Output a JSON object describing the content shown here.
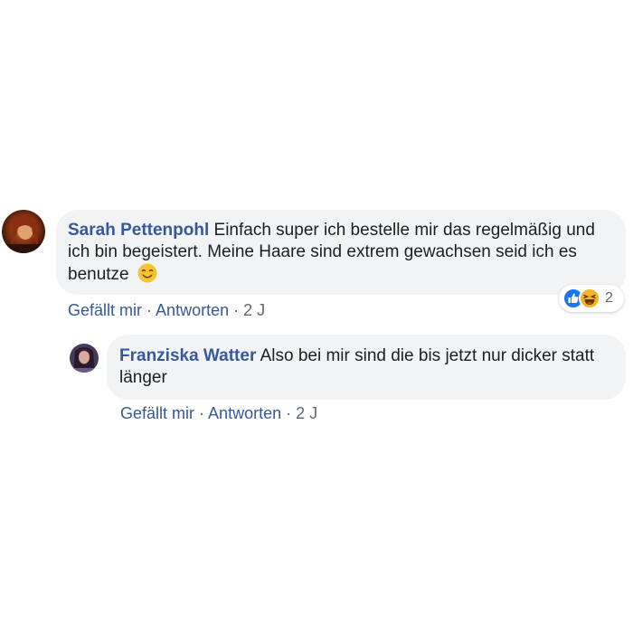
{
  "comments": [
    {
      "author": "Sarah Pettenpohl",
      "text": "Einfach super ich bestelle mir das regelmäßig und ich bin begeistert. Meine Haare sind extrem gewachsen seid ich es benutze",
      "emoji": "smiling-face-icon",
      "actions": {
        "like": "Gefällt mir",
        "reply": "Antworten",
        "time": "2 J"
      },
      "reactions": {
        "icons": [
          "like-reaction-icon",
          "haha-reaction-icon"
        ],
        "count": "2"
      }
    },
    {
      "author": "Franziska Watter",
      "text": "Also bei mir sind die bis jetzt nur dicker statt länger",
      "actions": {
        "like": "Gefällt mir",
        "reply": "Antworten",
        "time": "2 J"
      }
    }
  ],
  "separator": "·",
  "colors": {
    "link": "#385898",
    "bubble": "#f2f3f5",
    "text": "#1c1e21",
    "meta": "#606770",
    "like_blue": "#1877f2",
    "haha_yellow": "#f7b125"
  }
}
